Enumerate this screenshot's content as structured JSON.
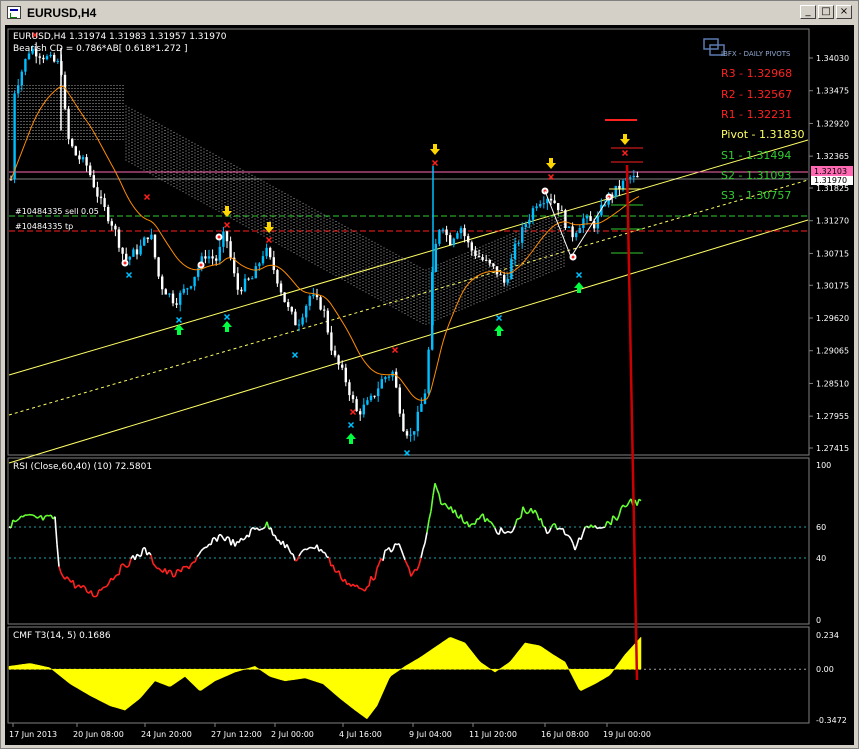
{
  "window": {
    "title": "EURUSD,H4",
    "buttons": {
      "minimize": "_",
      "maximize": "□",
      "close": "×"
    }
  },
  "chart": {
    "header": "EURUSD,H4  1.31974 1.31983 1.31957 1.31970",
    "pattern_label": "Bearish CD = 0.786*AB[ 0.618*1.272 ]",
    "order_sell_label": "#10484335 sell 0.05",
    "order_tp_label": "#10484335 tp",
    "price_axis": [
      "1.34030",
      "1.33475",
      "1.32920",
      "1.32365",
      "1.31825",
      "1.31270",
      "1.30715",
      "1.30175",
      "1.29620",
      "1.29065",
      "1.28510",
      "1.27955",
      "1.27415"
    ],
    "current_price_tag": "1.32103",
    "bid_price_tag": "1.31970",
    "time_axis": [
      "17 Jun 2013",
      "20 Jun 08:00",
      "24 Jun 20:00",
      "27 Jun 12:00",
      "2 Jul 00:00",
      "4 Jul 16:00",
      "9 Jul 04:00",
      "11 Jul 20:00",
      "16 Jul 08:00",
      "19 Jul 00:00"
    ],
    "pivots": {
      "logo_text": "IBFX - DAILY PIVOTS",
      "levels": [
        {
          "label": "R3 - 1.32968",
          "color": "#ff2020"
        },
        {
          "label": "R2 - 1.32567",
          "color": "#ff2020"
        },
        {
          "label": "R1 - 1.32231",
          "color": "#ff2020"
        },
        {
          "label": "Pivot - 1.31830",
          "color": "#ffff66"
        },
        {
          "label": "S1 - 1.31494",
          "color": "#32cd32"
        },
        {
          "label": "S2 - 1.31093",
          "color": "#32cd32"
        },
        {
          "label": "S3 - 1.30757",
          "color": "#32cd32"
        }
      ]
    },
    "colors": {
      "bull": "#00bfff",
      "bear": "#ffffff",
      "ma": "#ff8c00",
      "channel": "#ffff66",
      "arrow_up": "#00ff40",
      "arrow_down": "#ffd700",
      "cross_red": "#ff2020",
      "cross_cyan": "#00bfff"
    }
  },
  "rsi": {
    "label": "RSI (Close,60,40) (10) 72.5801",
    "levels": [
      "100",
      "60",
      "40",
      "0"
    ]
  },
  "cmf": {
    "label": "CMF T3(14, 5) 0.1686",
    "levels": [
      "0.234",
      "0.00",
      "-0.3472"
    ]
  }
}
